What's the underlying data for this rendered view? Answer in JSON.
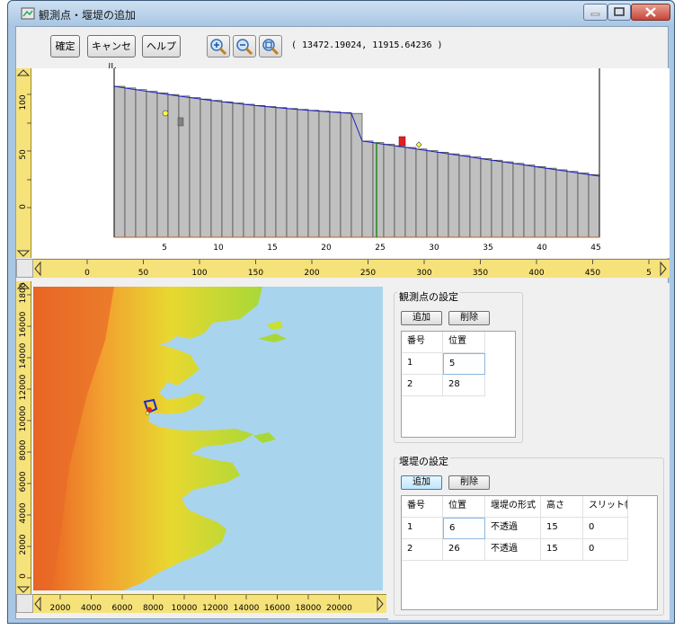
{
  "window": {
    "title": "観測点・堰堤の追加"
  },
  "toolbar": {
    "confirm_label": "確定",
    "cancel_label": "キャンセル",
    "help_label": "ヘルプ",
    "coordinates": "( 13472.19024, 11915.64236 )"
  },
  "profile": {
    "y_ticks": [
      "100",
      "50",
      "0"
    ],
    "x_ticks": [
      "5",
      "10",
      "15",
      "20",
      "25",
      "30",
      "35",
      "40",
      "45"
    ],
    "ruler_ticks": [
      "0",
      "50",
      "100",
      "150",
      "200",
      "250",
      "300",
      "350",
      "400",
      "450",
      "5"
    ]
  },
  "map": {
    "y_ruler_ticks": [
      "0",
      "2000",
      "4000",
      "6000",
      "8000",
      "10000",
      "12000",
      "14000",
      "16000",
      "1800"
    ],
    "x_ruler_ticks": [
      "2000",
      "4000",
      "6000",
      "8000",
      "10000",
      "12000",
      "14000",
      "16000",
      "18000",
      "20000"
    ]
  },
  "observation": {
    "title": "観測点の設定",
    "add_label": "追加",
    "delete_label": "削除",
    "headers": [
      "番号",
      "位置"
    ],
    "rows": [
      [
        "1",
        "5"
      ],
      [
        "2",
        "28"
      ]
    ]
  },
  "dam": {
    "title": "堰堤の設定",
    "add_label": "追加",
    "delete_label": "削除",
    "headers": [
      "番号",
      "位置",
      "堰堤の形式",
      "高さ",
      "スリット幅"
    ],
    "rows": [
      [
        "1",
        "6",
        "不透過",
        "15",
        "0"
      ],
      [
        "2",
        "26",
        "不透過",
        "15",
        "0"
      ]
    ]
  },
  "colors": {
    "bar_fill": "#c0c0c0",
    "profile_line": "#2020c0",
    "dam_marker": "#e02020",
    "observation_marker": "#ffff40",
    "ruler": "#f6e27a",
    "sea": "#a9d4ee"
  }
}
